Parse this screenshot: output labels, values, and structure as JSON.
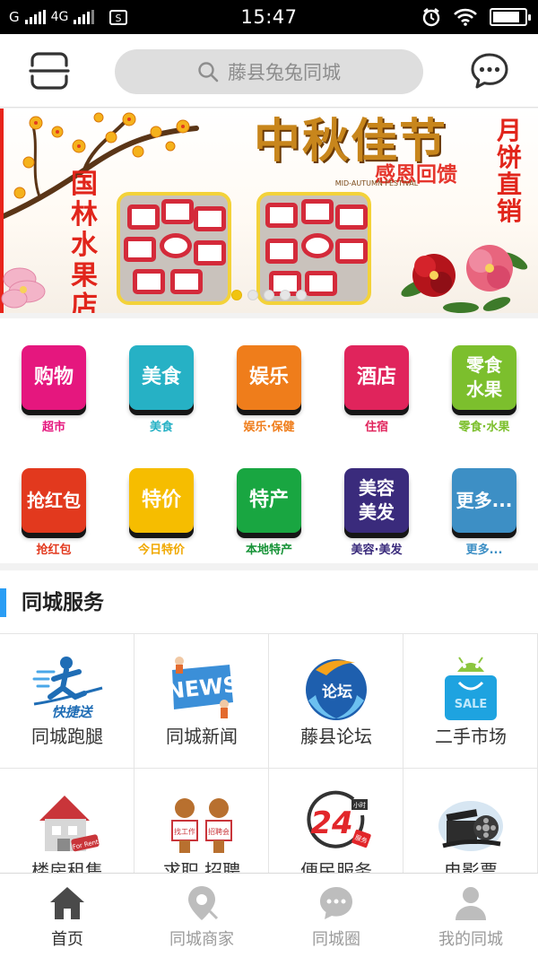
{
  "status_bar": {
    "carrier": "G",
    "network": "4G",
    "time": "15:47",
    "battery_level": 0.85
  },
  "header": {
    "search_placeholder": "藤县兔兔同城",
    "icons": {
      "left": "scan-icon",
      "search": "search-icon",
      "right": "chat-icon"
    }
  },
  "banner": {
    "shop_name": "国林水果店",
    "festival_title": "中秋佳节",
    "festival_subtitle": "感恩回馈",
    "festival_english": "MID-AUTUMN FESTIVAL",
    "side_text": "月饼直销",
    "slide_count": 5,
    "active_slide": 0
  },
  "categories": [
    {
      "tile": "购物",
      "caption": "超市",
      "color": "#e5177e",
      "caption_color": "#e5177e"
    },
    {
      "tile": "美食",
      "caption": "美食",
      "color": "#26b1c5",
      "caption_color": "#26b1c5"
    },
    {
      "tile": "娱乐",
      "caption": "娱乐·保健",
      "color": "#ef7d1b",
      "caption_color": "#ef7d1b"
    },
    {
      "tile": "酒店",
      "caption": "住宿",
      "color": "#e0245c",
      "caption_color": "#e0245c"
    },
    {
      "tile": "零食水果",
      "caption": "零食·水果",
      "color": "#7cbf2d",
      "caption_color": "#7cbf2d"
    },
    {
      "tile": "抢红包",
      "caption": "抢红包",
      "color": "#e2391e",
      "caption_color": "#e2391e"
    },
    {
      "tile": "特价",
      "caption": "今日特价",
      "color": "#f6bd00",
      "caption_color": "#f0a800"
    },
    {
      "tile": "特产",
      "caption": "本地特产",
      "color": "#19a641",
      "caption_color": "#159236"
    },
    {
      "tile": "美容美发",
      "caption": "美容·美发",
      "color": "#3a2b7c",
      "caption_color": "#3a2b7c"
    },
    {
      "tile": "更多...",
      "caption": "更多...",
      "color": "#3d8fc5",
      "caption_color": "#3d8fc5"
    }
  ],
  "services": {
    "title": "同城服务",
    "items": [
      {
        "label": "同城跑腿",
        "icon": "courier-icon"
      },
      {
        "label": "同城新闻",
        "icon": "news-icon"
      },
      {
        "label": "藤县论坛",
        "icon": "forum-icon"
      },
      {
        "label": "二手市场",
        "icon": "shopping-bag-icon"
      },
      {
        "label": "楼房租售",
        "icon": "house-icon"
      },
      {
        "label": "求职 招聘",
        "icon": "job-icon"
      },
      {
        "label": "便民服务",
        "icon": "24h-service-icon"
      },
      {
        "label": "电影票",
        "icon": "film-icon"
      }
    ],
    "icon_texts": {
      "courier": "快捷送",
      "news": "NEWS",
      "forum": "论坛",
      "sale": "SALE",
      "for_rent": "For Rent",
      "job_seek": "找工作",
      "job_fair": "招聘会",
      "h24": "24",
      "h24_hour": "小时",
      "h24_service": "服务"
    }
  },
  "bottom_nav": [
    {
      "label": "首页",
      "icon": "home-icon",
      "active": true
    },
    {
      "label": "同城商家",
      "icon": "location-pin-icon",
      "active": false
    },
    {
      "label": "同城圈",
      "icon": "chat-circle-icon",
      "active": false
    },
    {
      "label": "我的同城",
      "icon": "user-icon",
      "active": false
    }
  ]
}
